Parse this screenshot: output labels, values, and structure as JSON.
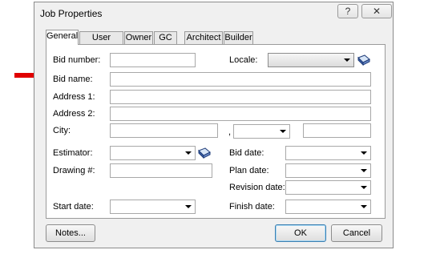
{
  "window": {
    "title": "Job Properties",
    "help_label": "?",
    "close_label": "✕"
  },
  "tabs": [
    "General",
    "User Fields",
    "Owner",
    "GC",
    "Architect",
    "Builder"
  ],
  "form": {
    "bid_number_label": "Bid number:",
    "locale_label": "Locale:",
    "bid_name_label": "Bid name:",
    "address1_label": "Address 1:",
    "address2_label": "Address 2:",
    "city_label": "City:",
    "city_separator": ",",
    "estimator_label": "Estimator:",
    "bid_date_label": "Bid date:",
    "drawing_label": "Drawing #:",
    "plan_date_label": "Plan date:",
    "revision_date_label": "Revision date:",
    "start_date_label": "Start date:",
    "finish_date_label": "Finish date:"
  },
  "buttons": {
    "notes": "Notes...",
    "ok": "OK",
    "cancel": "Cancel"
  },
  "colors": {
    "pointer_arrow": "#e00000",
    "default_button_border": "#3c7fb1"
  },
  "icons": {
    "locale_lookup": "address-book-icon",
    "estimator_lookup": "address-book-icon"
  }
}
